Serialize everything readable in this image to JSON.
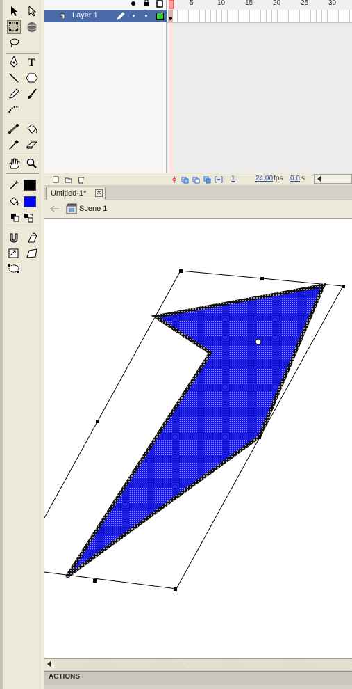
{
  "timeline": {
    "layer_name": "Layer 1",
    "ruler_numbers": [
      "5",
      "10",
      "15",
      "20",
      "25",
      "30"
    ],
    "current_frame": "1",
    "frame_rate": "24.00",
    "fps_unit": "fps",
    "elapsed_time": "0.0",
    "time_unit": "s"
  },
  "document": {
    "tab_title": "Untitled-1*",
    "scene_name": "Scene 1"
  },
  "tools": {
    "stroke_color": "#000000",
    "fill_color": "#0000ff"
  },
  "panels": {
    "actions_label": "ACTIONS"
  },
  "colors": {
    "selected_layer": "#4a6aa8",
    "playhead": "#e0393e",
    "shape_fill": "#1a1ae6",
    "layer_outline_swatch": "#33cc33"
  }
}
